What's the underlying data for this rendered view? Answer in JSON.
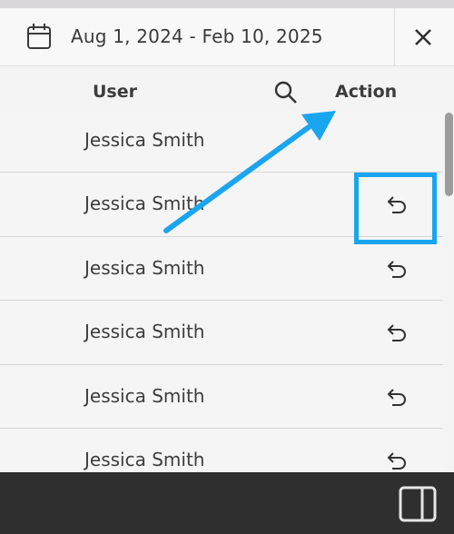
{
  "date_range": {
    "label": "Aug 1, 2024 - Feb 10, 2025"
  },
  "table": {
    "columns": {
      "user": "User",
      "action": "Action"
    },
    "rows": [
      {
        "user": "Jessica Smith",
        "has_undo": false
      },
      {
        "user": "Jessica Smith",
        "has_undo": true
      },
      {
        "user": "Jessica Smith",
        "has_undo": true
      },
      {
        "user": "Jessica Smith",
        "has_undo": true
      },
      {
        "user": "Jessica Smith",
        "has_undo": true
      },
      {
        "user": "Jessica Smith",
        "has_undo": true
      }
    ]
  },
  "annotation": {
    "color": "#1aa5f0",
    "icons": [
      "arrow",
      "highlight-box"
    ]
  },
  "icons": [
    "calendar-icon",
    "close-icon",
    "search-icon",
    "undo-icon",
    "side-panel-icon"
  ]
}
